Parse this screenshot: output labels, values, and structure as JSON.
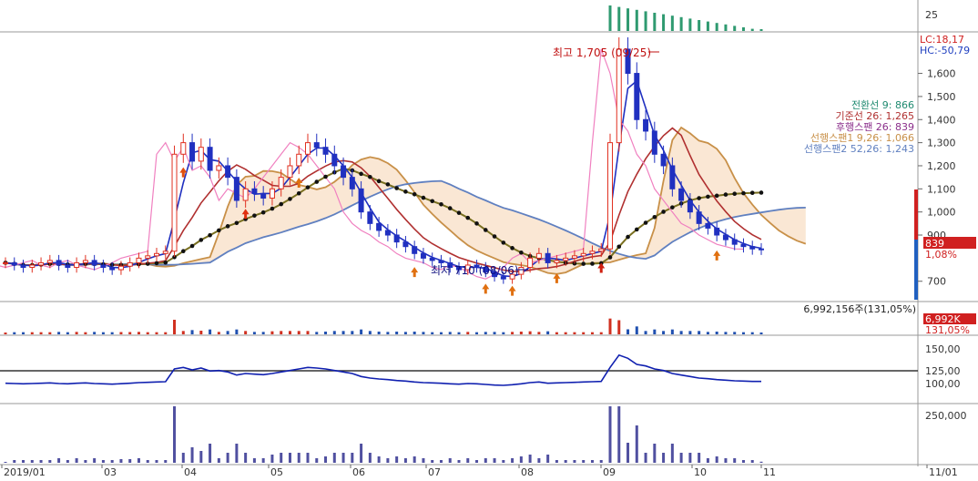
{
  "chart_data": {
    "type": "candlestick",
    "x_ticks": [
      "2019/01",
      "03",
      "04",
      "05",
      "06",
      "07",
      "08",
      "09",
      "10",
      "11",
      "11/01"
    ],
    "price_axis": {
      "ticks": [
        "1,600",
        "1,500",
        "1,400",
        "1,300",
        "1,200",
        "1,100",
        "1,000",
        "900",
        "700"
      ],
      "range": [
        620,
        1760
      ]
    },
    "top_axis": {
      "tick": "25"
    },
    "corner_labels": {
      "lc": "LC:18,17",
      "hc": "HC:-50,79"
    },
    "annotations": {
      "high": "최고 1,705 (09/25)",
      "low": "최저 710 (08/06)"
    },
    "ichimoku_legend": [
      {
        "text": "전환선 9: 866",
        "color": "#1f8a70"
      },
      {
        "text": "기준선 26: 1,265",
        "color": "#b03030"
      },
      {
        "text": "후행스팬 26: 839",
        "color": "#8b2f8b"
      },
      {
        "text": "선행스팬1 9,26: 1,066",
        "color": "#c89048"
      },
      {
        "text": "선행스팬2 52,26: 1,243",
        "color": "#6080c0"
      }
    ],
    "last_price": {
      "price": "839",
      "change": "1,08%"
    },
    "volume_panel": {
      "label": "6,992,156주(131,05%)",
      "badge_value": "6,992K",
      "badge_pct": "131,05%"
    },
    "indicator_panel": {
      "ticks": [
        "150,00",
        "125,00",
        "100,00"
      ]
    },
    "bottom_panel": {
      "tick": "250,000"
    },
    "close_series": [
      780,
      770,
      760,
      770,
      780,
      790,
      770,
      760,
      780,
      790,
      770,
      760,
      750,
      765,
      780,
      800,
      810,
      820,
      830,
      1250,
      1300,
      1220,
      1280,
      1180,
      1200,
      1150,
      1050,
      1100,
      1080,
      1060,
      1100,
      1150,
      1200,
      1250,
      1300,
      1280,
      1250,
      1200,
      1150,
      1100,
      1000,
      950,
      920,
      900,
      870,
      850,
      820,
      800,
      790,
      780,
      760,
      750,
      770,
      760,
      740,
      720,
      710,
      730,
      760,
      800,
      820,
      780,
      790,
      800,
      810,
      820,
      830,
      840,
      1300,
      1705,
      1600,
      1400,
      1350,
      1250,
      1200,
      1100,
      1050,
      1000,
      950,
      930,
      900,
      880,
      860,
      850,
      840,
      839
    ]
  },
  "colors": {
    "up": "#e03020",
    "down": "#2030c0",
    "tenkan": "#1f8a70",
    "kijun": "#b03030",
    "chikou": "#8b2f8b",
    "spanA": "#c89048",
    "spanB": "#6080c0",
    "volume_up": "#d03020",
    "volume_down": "#2050b0",
    "indicator": "#1020b0"
  }
}
